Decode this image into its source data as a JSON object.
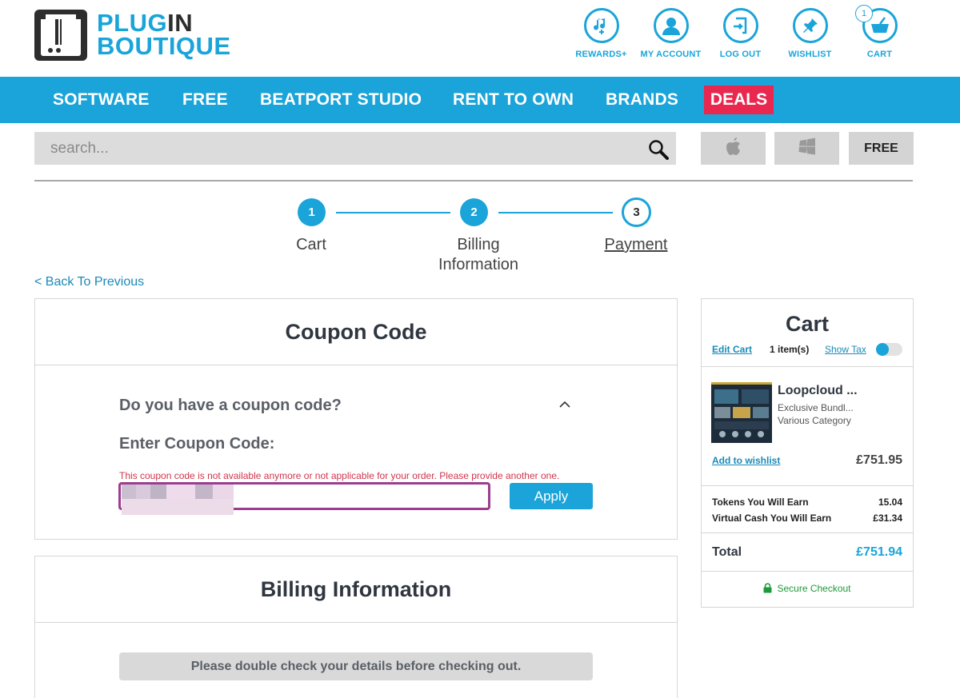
{
  "brand": {
    "line1_a": "PLUG",
    "line1_b": "IN",
    "line2": "BOUTIQUE"
  },
  "header_links": [
    {
      "label": "REWARDS+",
      "icon": "music-note-plus-icon"
    },
    {
      "label": "MY ACCOUNT",
      "icon": "user-icon"
    },
    {
      "label": "LOG OUT",
      "icon": "logout-icon"
    },
    {
      "label": "WISHLIST",
      "icon": "pin-icon"
    },
    {
      "label": "CART",
      "icon": "basket-icon",
      "badge": "1"
    }
  ],
  "nav": {
    "items": [
      "SOFTWARE",
      "FREE",
      "BEATPORT STUDIO",
      "RENT TO OWN",
      "BRANDS"
    ],
    "deals": "DEALS"
  },
  "search": {
    "placeholder": "search..."
  },
  "filters": {
    "free": "FREE"
  },
  "steps": [
    {
      "number": "1",
      "label": "Cart"
    },
    {
      "number": "2",
      "label_line1": "Billing",
      "label_line2": "Information"
    },
    {
      "number": "3",
      "label": "Payment"
    }
  ],
  "back_link": "< Back To Previous",
  "coupon": {
    "title": "Coupon Code",
    "question": "Do you have a coupon code?",
    "enter_label": "Enter Coupon Code:",
    "error": "This coupon code is not available anymore or not applicable for your order. Please provide another one.",
    "value": "",
    "apply": "Apply"
  },
  "billing": {
    "title": "Billing Information",
    "note": "Please double check your details before checking out."
  },
  "cart": {
    "title": "Cart",
    "edit": "Edit Cart",
    "count": "1 item(s)",
    "show_tax": "Show Tax",
    "product": {
      "name": "Loopcloud ...",
      "subtitle": "Exclusive Bundl...",
      "category": "Various Category",
      "wishlist": "Add to wishlist",
      "price": "£751.95"
    },
    "tokens_label": "Tokens You Will Earn",
    "tokens_value": "15.04",
    "cash_label": "Virtual Cash You Will Earn",
    "cash_value": "£31.34",
    "total_label": "Total",
    "total_value": "£751.94",
    "secure": "Secure Checkout"
  },
  "colors": {
    "accent": "#1aa4d9",
    "deals": "#e8284f",
    "error": "#d0354a",
    "secure": "#1f9a3a"
  }
}
